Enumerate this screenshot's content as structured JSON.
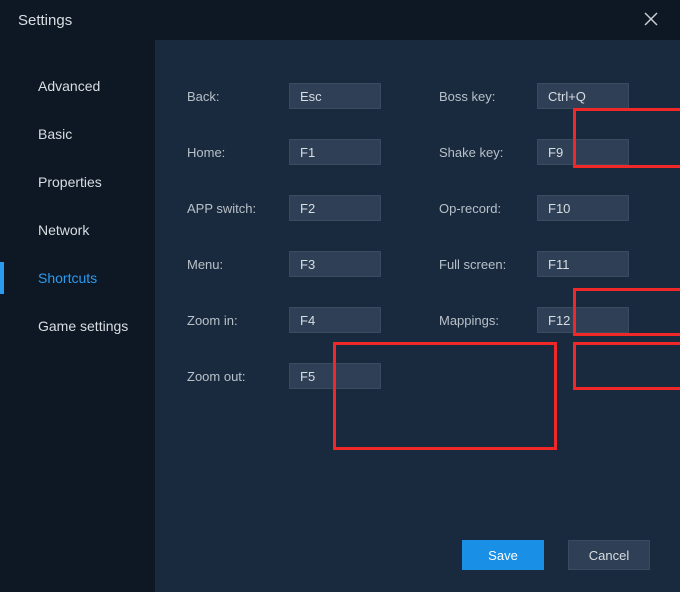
{
  "title": "Settings",
  "sidebar": {
    "items": [
      {
        "label": "Advanced"
      },
      {
        "label": "Basic"
      },
      {
        "label": "Properties"
      },
      {
        "label": "Network"
      },
      {
        "label": "Shortcuts"
      },
      {
        "label": "Game settings"
      }
    ],
    "activeIndex": 4
  },
  "shortcuts": {
    "back": {
      "label": "Back:",
      "value": "Esc"
    },
    "home": {
      "label": "Home:",
      "value": "F1"
    },
    "appswitch": {
      "label": "APP switch:",
      "value": "F2"
    },
    "menu": {
      "label": "Menu:",
      "value": "F3"
    },
    "zoomin": {
      "label": "Zoom in:",
      "value": "F4"
    },
    "zoomout": {
      "label": "Zoom out:",
      "value": "F5"
    },
    "bosskey": {
      "label": "Boss key:",
      "value": "Ctrl+Q"
    },
    "shakekey": {
      "label": "Shake key:",
      "value": "F9"
    },
    "oprecord": {
      "label": "Op-record:",
      "value": "F10"
    },
    "fullscreen": {
      "label": "Full screen:",
      "value": "F11"
    },
    "mappings": {
      "label": "Mappings:",
      "value": "F12"
    }
  },
  "buttons": {
    "save": "Save",
    "cancel": "Cancel"
  }
}
